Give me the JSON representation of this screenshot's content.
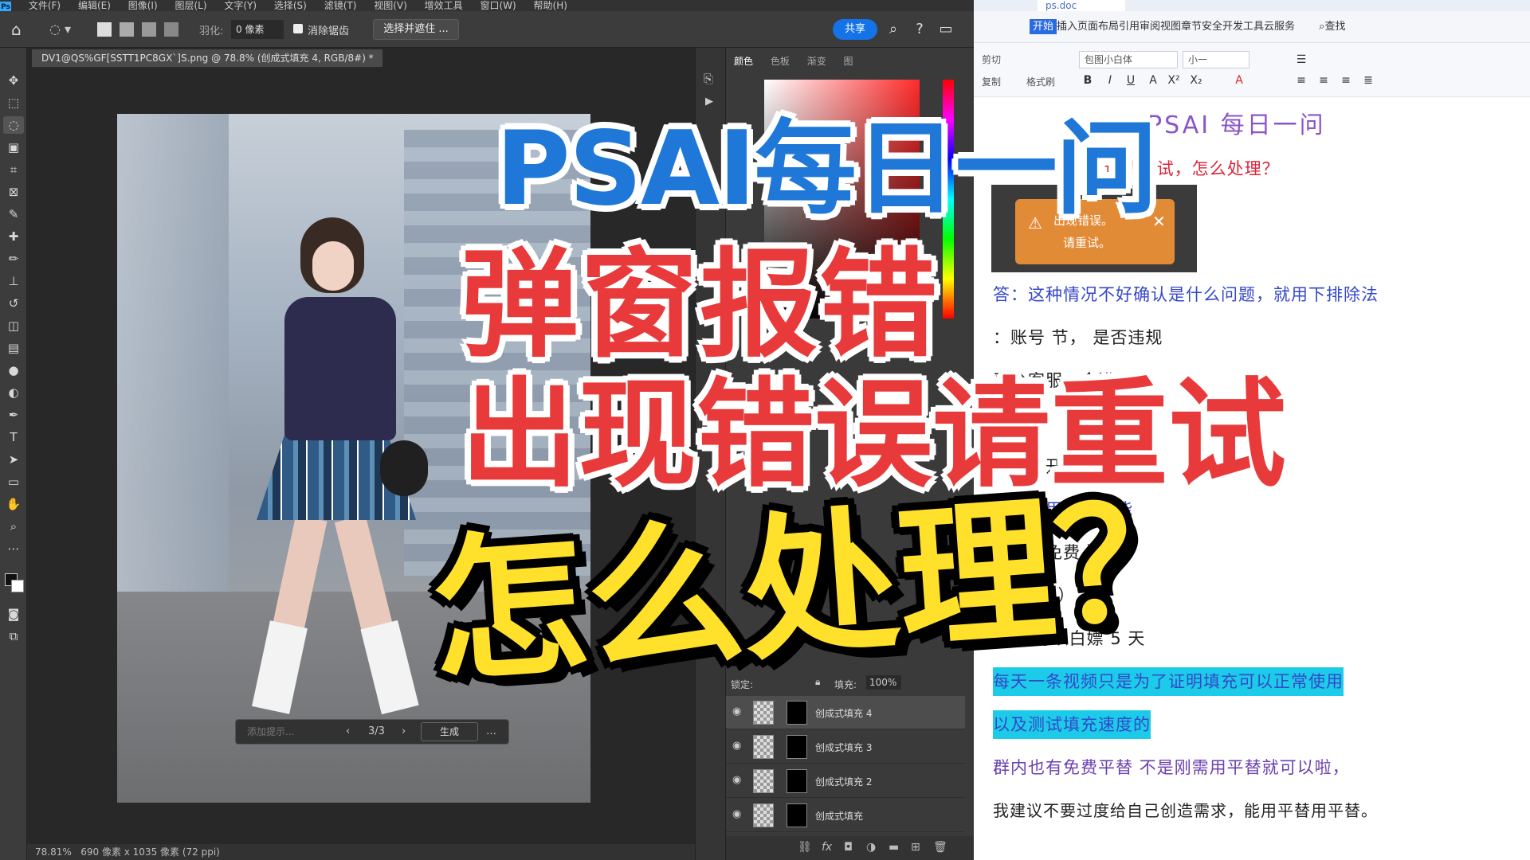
{
  "photoshop": {
    "menu": [
      "文件(F)",
      "编辑(E)",
      "图像(I)",
      "图层(L)",
      "文字(Y)",
      "选择(S)",
      "滤镜(T)",
      "视图(V)",
      "增效工具",
      "窗口(W)",
      "帮助(H)"
    ],
    "options": {
      "feather_label": "羽化:",
      "feather_value": "0 像素",
      "antialias_label": "消除锯齿",
      "select_mask_label": "选择并遮住 ...",
      "share_label": "共享"
    },
    "doc_tab": "DV1@QS%GF[SSTT1PC8GX`]S.png @ 78.8% (创成式填充 4, RGB/8#) *",
    "generate_bar": {
      "prompt_placeholder": "添加提示...",
      "counter": "3/3",
      "generate_label": "生成",
      "more": "…"
    },
    "status": {
      "zoom": "78.81%",
      "info": "690 像素 x 1035 像素 (72 ppi)"
    },
    "panels": {
      "tabs": [
        "颜色",
        "色板",
        "渐变",
        "图"
      ],
      "fill_label": "填充:",
      "fill_value": "100%",
      "lock_label": "锁定:"
    },
    "layers": [
      {
        "name": "创成式填充 4",
        "selected": true
      },
      {
        "name": "创成式填充 3",
        "selected": false
      },
      {
        "name": "创成式填充 2",
        "selected": false
      },
      {
        "name": "创成式填充",
        "selected": false
      }
    ]
  },
  "wps": {
    "doc_tab": "ps.doc",
    "menu_start": "开始",
    "menu_rest": "插入页面布局引用审阅视图章节安全开发工具云服务",
    "search": "查找",
    "clipboard": [
      "剪切",
      "复制",
      "格式刷"
    ],
    "font_name": "包图小白体",
    "font_size": "小一",
    "doc_title": "PSAI 每日一问",
    "question": "问：          ，出现错误请重试，怎么处理？",
    "error_toast": [
      "出现错误。",
      "请重试。"
    ],
    "lines": [
      "答：这种情况不好确认是什么问题，就用下排除法",
      "          ：账号    节，       是否违规",
      "                                       平台客服，会进行",
      "",
      "                                     重新打开 ps",
      "                                  正常使用填充功能",
      "                                    定时段免费 ）",
      "                       点          免费 ）",
      "                              十 ）可以白嫖 5 天",
      "每天一条视频只是为了证明填充可以正常使用",
      "以及测试填充速度的",
      "群内也有免费平替  不是刚需用平替就可以啦，",
      "我建议不要过度给自己创造需求，能用平替用平替。"
    ]
  },
  "overlay": {
    "line1": "PSAI每日一问",
    "line2": "弹窗报错",
    "line3": "出现错误请重试",
    "line4": "怎么处理？"
  }
}
